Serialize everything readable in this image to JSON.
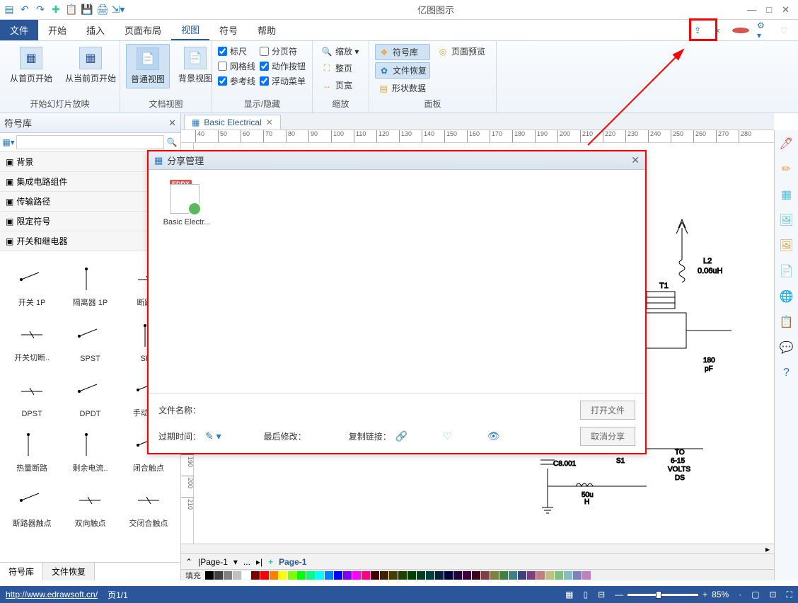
{
  "app_title": "亿图图示",
  "qat_icons": [
    "menu",
    "undo",
    "redo",
    "new",
    "paste",
    "save",
    "print",
    "export"
  ],
  "win": {
    "min": "—",
    "max": "□",
    "close": "✕"
  },
  "menu": {
    "file": "文件",
    "tabs": [
      "开始",
      "插入",
      "页面布局",
      "视图",
      "符号",
      "帮助"
    ],
    "active": "视图"
  },
  "right_menu_icons": [
    "share",
    "link",
    "cloud",
    "gear",
    "heart"
  ],
  "ribbon": {
    "g1": {
      "label": "开始幻灯片放映",
      "b1": "从首页开始",
      "b2": "从当前页开始"
    },
    "g2": {
      "label": "文档视图",
      "b1": "普通视图",
      "b2": "背景视图"
    },
    "g3": {
      "label": "显示/隐藏",
      "c": [
        [
          "标尺",
          true
        ],
        [
          "分页符",
          false
        ],
        [
          "网格线",
          false
        ],
        [
          "动作按钮",
          true
        ],
        [
          "参考线",
          true
        ],
        [
          "浮动菜单",
          true
        ]
      ]
    },
    "g4": {
      "label": "缩放",
      "b1": "缩放 ▾",
      "r1": "整页",
      "r2": "页宽"
    },
    "g5": {
      "label": "面板",
      "r1": "符号库",
      "r2": "文件恢复",
      "r3": "页面预览",
      "r4": "形状数据"
    }
  },
  "sidebar": {
    "title": "符号库",
    "cat": [
      "背景",
      "集成电路组件",
      "传输路径",
      "限定符号",
      "开关和继电器"
    ],
    "shapes": [
      [
        "开关 1P",
        "隔离器 1P",
        "断路器"
      ],
      [
        "开关切断..",
        "SPST",
        "SPD"
      ],
      [
        "DPST",
        "DPDT",
        "手动开关"
      ],
      [
        "热量断路",
        "剩余电流..",
        "闭合触点"
      ],
      [
        "断路器触点",
        "双向触点",
        "交闭合触点"
      ]
    ],
    "tabs": [
      "符号库",
      "文件恢复"
    ]
  },
  "doc_tab": "Basic Electrical",
  "hruler": [
    40,
    50,
    60,
    70,
    80,
    90,
    100,
    110,
    120,
    130,
    140,
    150,
    160,
    170,
    180,
    190,
    200,
    210,
    220,
    230,
    240,
    250,
    260,
    270,
    280
  ],
  "vruler": [
    190,
    200,
    210
  ],
  "circuit": {
    "l2": "L2",
    "l2v": "0.06uH",
    "t1": "T1",
    "c8": "C8.001",
    "v50": "50u",
    "vh": "H",
    "v180": "180",
    "pf": "pF",
    "s1": "S1",
    "to": "TO",
    "volts": "6-15\nVOLTS\nDS"
  },
  "dialog": {
    "title": "分享管理",
    "badge": "EDDX",
    "filename": "Basic Electr...",
    "fn_label": "文件名称：",
    "exp_label": "过期时间：",
    "mod_label": "最后修改：",
    "copy_label": "复制链接：",
    "open_btn": "打开文件",
    "cancel_btn": "取消分享"
  },
  "page_tabs": {
    "p1": "Page-1",
    "p2": "Page-1",
    "add": "+"
  },
  "color_label": "填充",
  "colors": [
    "#000",
    "#404040",
    "#808080",
    "#c0c0c0",
    "#fff",
    "#800000",
    "#f00",
    "#ff8000",
    "#ff0",
    "#80ff00",
    "#0f0",
    "#00ff80",
    "#0ff",
    "#0080ff",
    "#00f",
    "#8000ff",
    "#f0f",
    "#ff0080",
    "#400000",
    "#402000",
    "#404000",
    "#204000",
    "#004000",
    "#004020",
    "#004040",
    "#002040",
    "#000040",
    "#200040",
    "#400040",
    "#400020",
    "#804040",
    "#808040",
    "#408040",
    "#408080",
    "#404080",
    "#804080",
    "#c08080",
    "#c0c080",
    "#80c080",
    "#80c0c0",
    "#8080c0",
    "#c080c0"
  ],
  "status": {
    "url": "http://www.edrawsoft.cn/",
    "page": "页1/1",
    "zoom": "85%"
  },
  "right_tools": [
    "🖊",
    "✏",
    "▦",
    "🖼",
    "🖼",
    "📄",
    "🌐",
    "📋",
    "💬",
    "?"
  ]
}
